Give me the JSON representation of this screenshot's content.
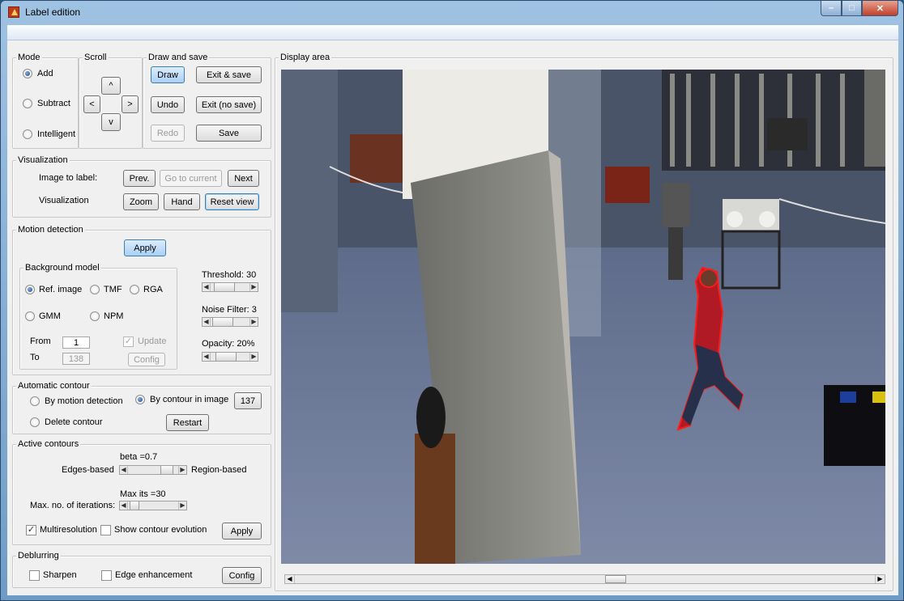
{
  "window": {
    "title": "Label edition"
  },
  "mode": {
    "title": "Mode",
    "options": [
      "Add",
      "Subtract",
      "Intelligent"
    ],
    "selected": "Add"
  },
  "scroll": {
    "title": "Scroll",
    "up": "^",
    "left": "<",
    "right": ">",
    "down": "v"
  },
  "draw_save": {
    "title": "Draw and save",
    "draw": "Draw",
    "exit_save": "Exit & save",
    "undo": "Undo",
    "exit_nosave": "Exit (no save)",
    "redo": "Redo",
    "save": "Save"
  },
  "visualization": {
    "title": "Visualization",
    "image_label": "Image to label:",
    "prev": "Prev.",
    "go_current": "Go to current",
    "next": "Next",
    "vis_label": "Visualization",
    "zoom": "Zoom",
    "hand": "Hand",
    "reset": "Reset view"
  },
  "motion": {
    "title": "Motion detection",
    "apply": "Apply",
    "bg_title": "Background model",
    "models": [
      "Ref. image",
      "TMF",
      "RGA",
      "GMM",
      "NPM"
    ],
    "selected": "Ref. image",
    "from_label": "From",
    "from_value": "1",
    "to_label": "To",
    "to_value": "138",
    "update": "Update",
    "config": "Config",
    "threshold": "Threshold: 30",
    "noise": "Noise Filter: 3",
    "opacity": "Opacity: 20%"
  },
  "auto_contour": {
    "title": "Automatic contour",
    "by_motion": "By motion detection",
    "by_contour": "By contour in image",
    "contour_value": "137",
    "delete": "Delete contour",
    "restart": "Restart",
    "selected": "By contour in image"
  },
  "active_contours": {
    "title": "Active contours",
    "beta": "beta =0.7",
    "edges": "Edges-based",
    "region": "Region-based",
    "max_its": "Max its =30",
    "iterations": "Max. no. of iterations:",
    "multires": "Multiresolution",
    "show_evolution": "Show contour evolution",
    "apply": "Apply"
  },
  "deblurring": {
    "title": "Deblurring",
    "sharpen": "Sharpen",
    "edge": "Edge enhancement",
    "config": "Config"
  },
  "display": {
    "title": "Display area"
  },
  "colors": {
    "contour": "#ff1a1a",
    "accent": "#3c7fb1"
  }
}
